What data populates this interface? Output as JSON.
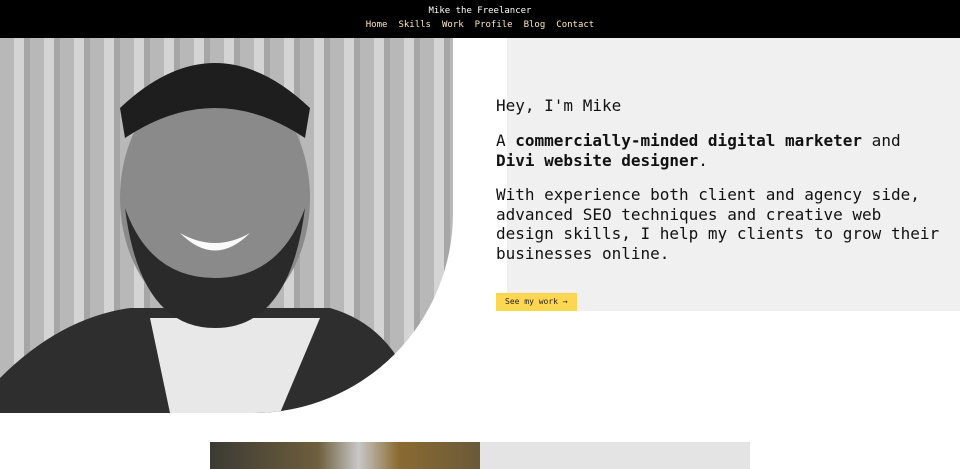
{
  "header": {
    "site_title": "Mike the Freelancer",
    "nav": [
      "Home",
      "Skills",
      "Work",
      "Profile",
      "Blog",
      "Contact"
    ]
  },
  "hero": {
    "greeting": "Hey, I'm Mike",
    "tagline": {
      "a": "A ",
      "b1": "commercially-minded digital marketer",
      "c": " and ",
      "b2": "Divi website designer",
      "d": "."
    },
    "description": "With experience both client and agency side, advanced SEO techniques and creative web design skills, I help my clients to grow their businesses online.",
    "cta_label": "See my work →"
  },
  "colors": {
    "accent": "#ffd64f",
    "nav_link": "#ffe9b8",
    "panel": "#f0f0f0"
  }
}
